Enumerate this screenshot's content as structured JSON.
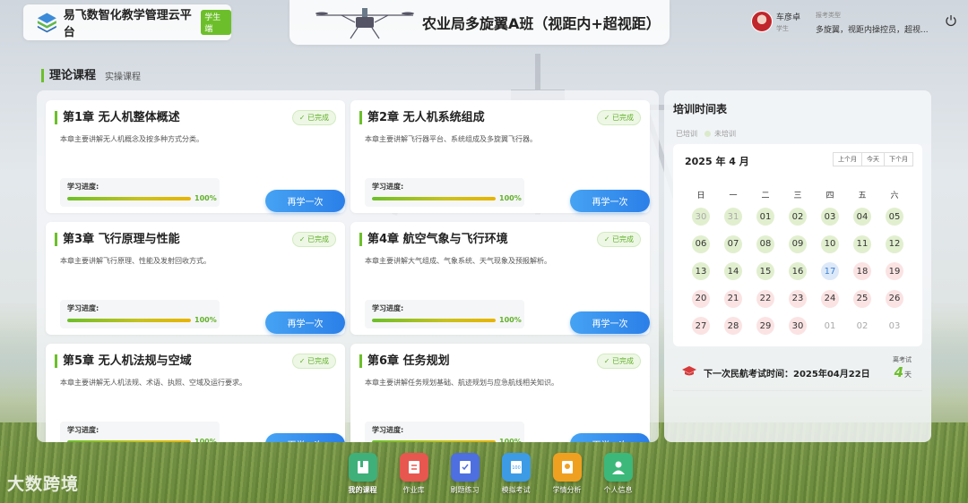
{
  "brand": {
    "name": "易飞数智化教学管理云平台",
    "tag": "学生端"
  },
  "header": {
    "class_title": "农业局多旋翼A班（视距内+超视距）"
  },
  "user": {
    "name": "车彦卓",
    "role": "学生",
    "exam_type_label": "报考类型",
    "exam_type_value": "多旋翼，视距内操控员，超视..."
  },
  "tabs": {
    "active": "理论课程",
    "other": "实操课程"
  },
  "courses": [
    {
      "title": "第1章 无人机整体概述",
      "status": "已完成",
      "desc": "本章主要讲解无人机概念及按多种方式分类。",
      "progress_label": "学习进度:",
      "progress": 100,
      "progress_text": "100%",
      "button": "再学一次"
    },
    {
      "title": "第2章 无人机系统组成",
      "status": "已完成",
      "desc": "本章主要讲解飞行器平台、系统组成及多旋翼飞行器。",
      "progress_label": "学习进度:",
      "progress": 100,
      "progress_text": "100%",
      "button": "再学一次"
    },
    {
      "title": "第3章 飞行原理与性能",
      "status": "已完成",
      "desc": "本章主要讲解飞行原理、性能及发射回收方式。",
      "progress_label": "学习进度:",
      "progress": 100,
      "progress_text": "100%",
      "button": "再学一次"
    },
    {
      "title": "第4章 航空气象与飞行环境",
      "status": "已完成",
      "desc": "本章主要讲解大气组成、气象系统、天气现象及预报解析。",
      "progress_label": "学习进度:",
      "progress": 100,
      "progress_text": "100%",
      "button": "再学一次"
    },
    {
      "title": "第5章 无人机法规与空域",
      "status": "已完成",
      "desc": "本章主要讲解无人机法规、术语、执照、空域及运行要求。",
      "progress_label": "学习进度:",
      "progress": 100,
      "progress_text": "100%",
      "button": "再学一次"
    },
    {
      "title": "第6章 任务规划",
      "status": "已完成",
      "desc": "本章主要讲解任务规划基础、航迹规划与应急航线相关知识。",
      "progress_label": "学习进度:",
      "progress": 100,
      "progress_text": "100%",
      "button": "再学一次"
    }
  ],
  "schedule": {
    "title": "培训时间表",
    "legend_trained": "已培训",
    "legend_untrained": "未培训",
    "month": "2025 年 4 月",
    "nav": [
      "上个月",
      "今天",
      "下个月"
    ],
    "weekdays": [
      "日",
      "一",
      "二",
      "三",
      "四",
      "五",
      "六"
    ],
    "days": [
      {
        "d": "30",
        "s": "trained-muted"
      },
      {
        "d": "31",
        "s": "trained-muted"
      },
      {
        "d": "01",
        "s": "trained"
      },
      {
        "d": "02",
        "s": "trained"
      },
      {
        "d": "03",
        "s": "trained"
      },
      {
        "d": "04",
        "s": "trained"
      },
      {
        "d": "05",
        "s": "trained"
      },
      {
        "d": "06",
        "s": "trained"
      },
      {
        "d": "07",
        "s": "trained"
      },
      {
        "d": "08",
        "s": "trained"
      },
      {
        "d": "09",
        "s": "trained"
      },
      {
        "d": "10",
        "s": "trained"
      },
      {
        "d": "11",
        "s": "trained"
      },
      {
        "d": "12",
        "s": "trained"
      },
      {
        "d": "13",
        "s": "trained"
      },
      {
        "d": "14",
        "s": "trained"
      },
      {
        "d": "15",
        "s": "trained"
      },
      {
        "d": "16",
        "s": "trained"
      },
      {
        "d": "17",
        "s": "today"
      },
      {
        "d": "18",
        "s": "untrained"
      },
      {
        "d": "19",
        "s": "untrained"
      },
      {
        "d": "20",
        "s": "untrained"
      },
      {
        "d": "21",
        "s": "untrained"
      },
      {
        "d": "22",
        "s": "untrained"
      },
      {
        "d": "23",
        "s": "untrained"
      },
      {
        "d": "24",
        "s": "untrained"
      },
      {
        "d": "25",
        "s": "untrained"
      },
      {
        "d": "26",
        "s": "untrained"
      },
      {
        "d": "27",
        "s": "untrained"
      },
      {
        "d": "28",
        "s": "untrained"
      },
      {
        "d": "29",
        "s": "untrained"
      },
      {
        "d": "30",
        "s": "untrained"
      },
      {
        "d": "01",
        "s": "muted"
      },
      {
        "d": "02",
        "s": "muted"
      },
      {
        "d": "03",
        "s": "muted"
      }
    ],
    "exam_text": "下一次民航考试时间：2025年04月22日",
    "days_left_label": "离考试",
    "days_left": "4",
    "days_unit": "天"
  },
  "bottom_nav": [
    {
      "label": "我的课程",
      "icon": "book-icon",
      "color": "#3fb07a",
      "active": true
    },
    {
      "label": "作业库",
      "icon": "homework-icon",
      "color": "#e8574f",
      "active": false
    },
    {
      "label": "刷题练习",
      "icon": "practice-icon",
      "color": "#4d6fe0",
      "active": false
    },
    {
      "label": "模拟考试",
      "icon": "exam-icon",
      "color": "#3d9be6",
      "active": false
    },
    {
      "label": "学情分析",
      "icon": "analysis-icon",
      "color": "#f0a020",
      "active": false
    },
    {
      "label": "个人信息",
      "icon": "user-icon",
      "color": "#3cb87a",
      "active": false
    }
  ],
  "watermark": "大数跨境",
  "colors": {
    "accent": "#6cbf2a",
    "button": "#2b7fe8",
    "today": "#3b82d4"
  }
}
